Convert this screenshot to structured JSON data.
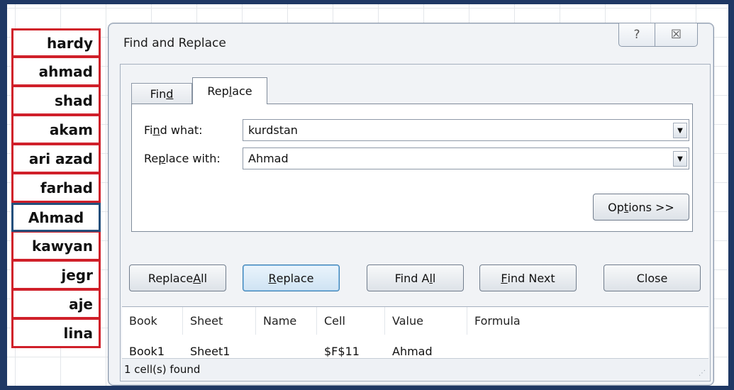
{
  "sheet": {
    "names": [
      "hardy",
      "ahmad",
      "shad",
      "akam",
      "ari azad",
      "farhad",
      "Ahmad",
      "kawyan",
      "jegr",
      "aje",
      "lina"
    ],
    "active_index": 6
  },
  "dialog": {
    "title": "Find and Replace",
    "help_glyph": "?",
    "close_glyph": "☒",
    "tabs": {
      "find": {
        "pre": "Fin",
        "key": "d",
        "post": ""
      },
      "replace": {
        "pre": "Rep",
        "key": "l",
        "post": "ace"
      }
    },
    "find_what": {
      "pre": "Fi",
      "key": "n",
      "post": "d what:",
      "value": "kurdstan"
    },
    "replace_with": {
      "pre": "Re",
      "key": "p",
      "post": "lace with:",
      "value": "Ahmad"
    },
    "options_button": {
      "pre": "Op",
      "key": "t",
      "post": "ions >>"
    },
    "buttons": {
      "replace_all": {
        "pre": "Replace ",
        "key": "A",
        "post": "ll"
      },
      "replace": {
        "pre": "",
        "key": "R",
        "post": "eplace"
      },
      "find_all": {
        "pre": "Find A",
        "key": "l",
        "post": "l"
      },
      "find_next": {
        "pre": "",
        "key": "F",
        "post": "ind Next"
      },
      "close": {
        "label": "Close"
      }
    },
    "results": {
      "columns": [
        "Book",
        "Sheet",
        "Name",
        "Cell",
        "Value",
        "Formula"
      ],
      "rows": [
        {
          "book": "Book1",
          "sheet": "Sheet1",
          "name": "",
          "cell": "$F$11",
          "value": "Ahmad",
          "formula": ""
        }
      ],
      "status": "1 cell(s) found"
    }
  }
}
